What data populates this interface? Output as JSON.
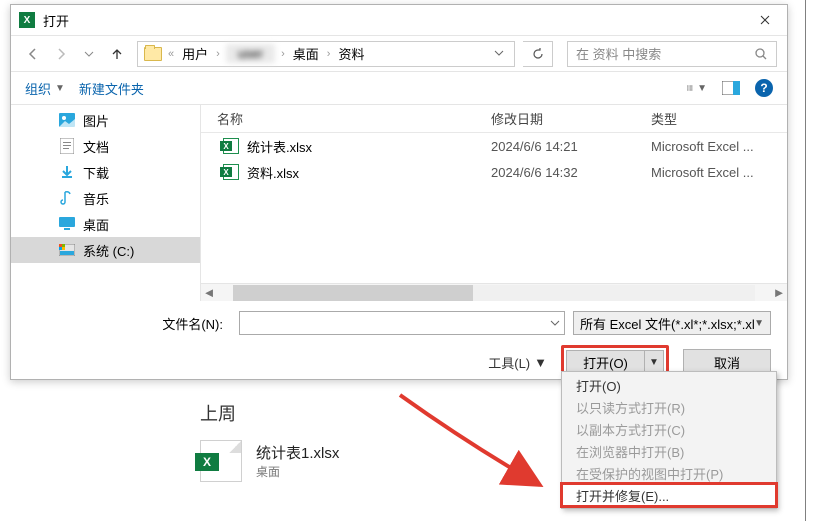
{
  "title": "打开",
  "breadcrumb": {
    "sep": "›",
    "root_sep": "«",
    "items": [
      "用户",
      "████",
      "桌面",
      "资料"
    ]
  },
  "search": {
    "placeholder": "在 资料 中搜索"
  },
  "toolbar": {
    "organize": "组织",
    "newfolder": "新建文件夹"
  },
  "tree": [
    {
      "label": "图片",
      "icon": "image",
      "color": "#2aa7dd"
    },
    {
      "label": "文档",
      "icon": "doc",
      "color": "#7a7a7a"
    },
    {
      "label": "下载",
      "icon": "download",
      "color": "#2aa7dd"
    },
    {
      "label": "音乐",
      "icon": "music",
      "color": "#2aa7dd"
    },
    {
      "label": "桌面",
      "icon": "desktop",
      "color": "#2aa7dd"
    },
    {
      "label": "系统 (C:)",
      "icon": "drive",
      "color": "#2aa7dd",
      "selected": true
    }
  ],
  "columns": {
    "name": "名称",
    "date": "修改日期",
    "type": "类型"
  },
  "files": [
    {
      "name": "统计表.xlsx",
      "date": "2024/6/6 14:21",
      "type": "Microsoft Excel ..."
    },
    {
      "name": "资料.xlsx",
      "date": "2024/6/6 14:32",
      "type": "Microsoft Excel ..."
    }
  ],
  "footer": {
    "filename_label": "文件名(N):",
    "filter": "所有 Excel 文件(*.xl*;*.xlsx;*.xl",
    "tools": "工具(L)",
    "open": "打开(O)",
    "cancel": "取消"
  },
  "menu": [
    {
      "label": "打开(O)",
      "disabled": false
    },
    {
      "label": "以只读方式打开(R)",
      "disabled": true
    },
    {
      "label": "以副本方式打开(C)",
      "disabled": true
    },
    {
      "label": "在浏览器中打开(B)",
      "disabled": true
    },
    {
      "label": "在受保护的视图中打开(P)",
      "disabled": true
    },
    {
      "label": "打开并修复(E)...",
      "disabled": false,
      "highlight": true
    }
  ],
  "background": {
    "heading": "上周",
    "file_name": "统计表1.xlsx",
    "file_sub": "桌面"
  }
}
